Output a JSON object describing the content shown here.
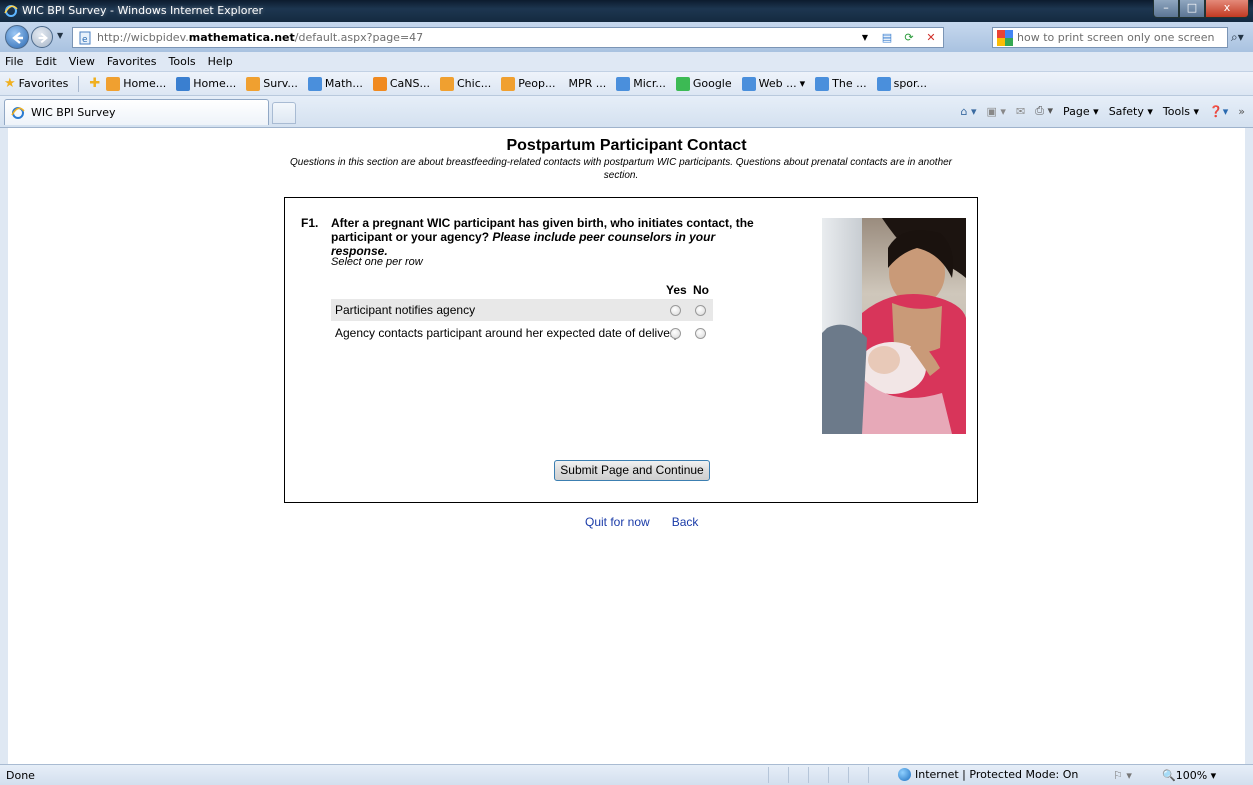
{
  "window": {
    "title": "WIC BPI Survey - Windows Internet Explorer",
    "controls": {
      "minimize": "–",
      "maximize": "□",
      "close": "x"
    }
  },
  "address_bar": {
    "url_prefix": "http://wicbpidev.",
    "url_domain": "mathematica.net",
    "url_path": "/default.aspx?page=47"
  },
  "search": {
    "value": "how to print screen only one screen"
  },
  "menu": [
    "File",
    "Edit",
    "View",
    "Favorites",
    "Tools",
    "Help"
  ],
  "favorites_bar": {
    "favorites_label": "Favorites",
    "items": [
      "Home...",
      "Home...",
      "Surv...",
      "Math...",
      "CaNS...",
      "Chic...",
      "Peop...",
      "MPR ...",
      "Micr...",
      "Google",
      "Web ...",
      "The ...",
      "spor..."
    ],
    "item_colors": [
      "#f0a030",
      "#3a7fd0",
      "#f0a030",
      "#4a8fdc",
      "#f08a20",
      "#f0a030",
      "#f0a030",
      "#ffffff",
      "#4a8fdc",
      "#3cba54",
      "#4a8fdc",
      "#4a8fdc",
      "#4a8fdc"
    ]
  },
  "tab": {
    "label": "WIC BPI Survey"
  },
  "command_bar": {
    "page": "Page",
    "safety": "Safety",
    "tools": "Tools"
  },
  "survey": {
    "title": "Postpartum Participant Contact",
    "subtitle": "Questions in this section are about breastfeeding-related contacts with postpartum WIC participants. Questions about prenatal contacts are in another section.",
    "question_number": "F1.",
    "question_text": "After a pregnant WIC participant has given birth, who initiates contact, the participant or your agency?",
    "question_emphasis": "Please include peer counselors in your response.",
    "instruction": "Select one per row",
    "columns": [
      "Yes",
      "No"
    ],
    "rows": [
      {
        "label": "Participant notifies agency",
        "selected": null
      },
      {
        "label": "Agency contacts participant around her expected date of delivery",
        "selected": null
      }
    ],
    "submit_label": "Submit Page and Continue",
    "quit_label": "Quit for now",
    "back_label": "Back"
  },
  "status_bar": {
    "status": "Done",
    "zone": "Internet | Protected Mode: On",
    "zoom": "100%"
  },
  "colors": {
    "link": "#1a3ba8",
    "chrome": "#dfe8f3",
    "row_shade": "#e8e8e8"
  }
}
